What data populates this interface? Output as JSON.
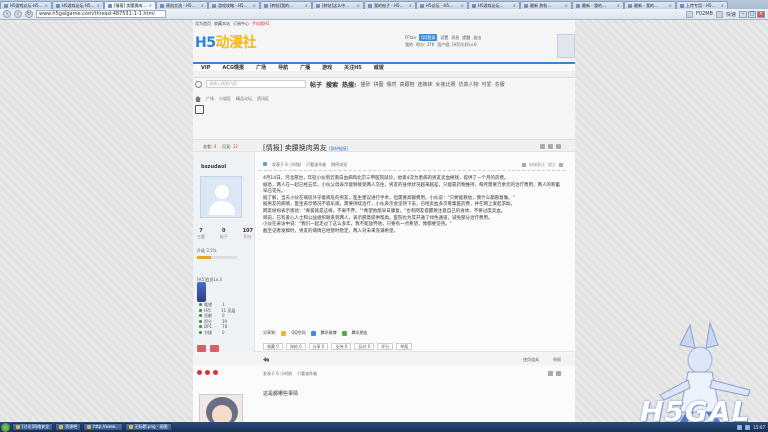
{
  "browser": {
    "tabs": [
      {
        "label": "H5游戏论坛-H5..."
      },
      {
        "label": "H5游戏论坛-H5..."
      },
      {
        "label": "[情报] 卖腰换肉..."
      },
      {
        "label": "原创交流 - H5..."
      },
      {
        "label": "游戏攻略 - H5..."
      },
      {
        "label": "[转帖]我的..."
      },
      {
        "label": "[转帖]这么中..."
      },
      {
        "label": "我的帖子 - H5..."
      },
      {
        "label": "H5论坛 - H5..."
      },
      {
        "label": "H5游戏论坛..."
      },
      {
        "label": "最新 热帖..."
      },
      {
        "label": "最新 - 我的..."
      },
      {
        "label": "最新 - 我的..."
      },
      {
        "label": "上传专用 - H5..."
      }
    ],
    "url": "www.h5galgame.com/thread-487531-1-1.html",
    "zoom": "F02MB",
    "status_right": "快速"
  },
  "site": {
    "top_links": [
      "设为首页",
      "收藏本站",
      "订阅中心"
    ],
    "top_link_red": "手机版H5",
    "logo_text": "H5",
    "logo_suffix": "动漫社",
    "user": {
      "row1": [
        "FFfan",
        "QQ登录",
        "设置",
        "消息",
        "提醒",
        "退出"
      ],
      "row2": [
        "我的",
        "积分: 376",
        "用户组: [H5]大好Lv.6"
      ]
    },
    "nav": [
      "VIP",
      "ACG情报",
      "广场",
      "导航",
      "广播",
      "游戏",
      "关注H5",
      "威望"
    ],
    "search": {
      "placeholder": "请输入搜索内容",
      "scope": "帖子",
      "button": "搜索",
      "hot_label": "热搜:",
      "hot_words": [
        "猫砂",
        "拼图",
        "偶然",
        "高跟鞋",
        "连裤袜",
        "女装比赛",
        "仿真人物",
        "可爱",
        "衣服"
      ]
    },
    "breadcrumb": [
      "广场",
      "小说区",
      "精品论坛",
      "资讯区"
    ]
  },
  "thread": {
    "views_label": "查看:",
    "views": "4",
    "replies_label": "回复:",
    "replies": "12",
    "category": "[情报]",
    "title": "卖腰换肉男友",
    "tag": "[复制链接]"
  },
  "post": {
    "author": "bszudaoI",
    "meta": [
      "发表于 6 小时前",
      "只看该作者",
      "倒序浏览"
    ],
    "mod_tools": [
      "电梯直达",
      "楼主"
    ],
    "stats": [
      {
        "value": "7",
        "label": "主题"
      },
      {
        "value": "0",
        "label": "帖子"
      },
      {
        "value": "107",
        "label": "积分"
      }
    ],
    "rank": "升级 3.5%",
    "rank_progress": 0.35,
    "group": "[H5]会员Lv.3",
    "attrs": [
      {
        "label": "威望",
        "value": "1"
      },
      {
        "label": "H币",
        "value": "11 灵晶"
      },
      {
        "label": "贡献",
        "value": "0"
      },
      {
        "label": "积分",
        "value": "19"
      },
      {
        "label": "DP1",
        "value": "78"
      },
      {
        "label": "节操",
        "value": "0"
      }
    ],
    "body": [
      "4月14日，河北邢台，年轻小伙到云南白血病和北京三甲医院就诊，他第4次为患病的男友卖血换钱，提供了一个月的药费。",
      "据悉，两人在一起已经五年，小伙父母表示能够接受两人交往，男友的身体状况越来越差，只能靠药物维持，每月需要万余元的治疗费用，两人的积蓄早已花光。",
      "据了解，当天小伙在病房外守着病危的男友，医生建议进行手术，但需要高额费用。小伙说：\"只要能救他，我什么都愿意做。\"",
      "据男友的病情，医生表示情况不容乐观，需要持续治疗，小伙表示会坚持下去，已经卖血多次筹集医药费，并在网上发起求助。",
      "网友纷纷表示感动：\"真爱就是这样，不离不弃。\"\"希望他能早日康复。\"也有网友提醒要注意自己的身体，不要过度卖血。",
      "目前，已有爱心人士和公益组织联系到两人，表示愿意提供帮助。医院也为其开通了绿色通道，减免部分治疗费用。",
      "小伙在采访中说：\"我们一起走过了这么多年，我不能放弃他，只要有一点希望，我都要坚持。\"",
      "截至记者发稿时，男友的病情已经暂时稳定，两人对未来充满希望。"
    ],
    "share_label": "分享到:",
    "share_items": [
      "QQ空间",
      "腾讯微博",
      "腾讯朋友"
    ],
    "actions": [
      "收藏 0",
      "淘帖 0",
      "分享 0",
      "支持 0",
      "反对 0",
      "评分",
      "举报"
    ]
  },
  "post_foot": {
    "items": [
      "使用道具",
      "举报"
    ]
  },
  "post2": {
    "meta": [
      "发表于 6 小时前",
      "只看该作者"
    ],
    "text": "这是都哪些事情"
  },
  "watermark": "H5GAL",
  "taskbar": {
    "items": [
      "[讨论]网络安全",
      "资源吧",
      "http://www...",
      "无标题.png - 画图"
    ],
    "clock": "15:07"
  },
  "colors": {
    "accent": "#3a83cf",
    "logo_yellow": "#f5b81b",
    "highlight_red": "#dd3333"
  }
}
